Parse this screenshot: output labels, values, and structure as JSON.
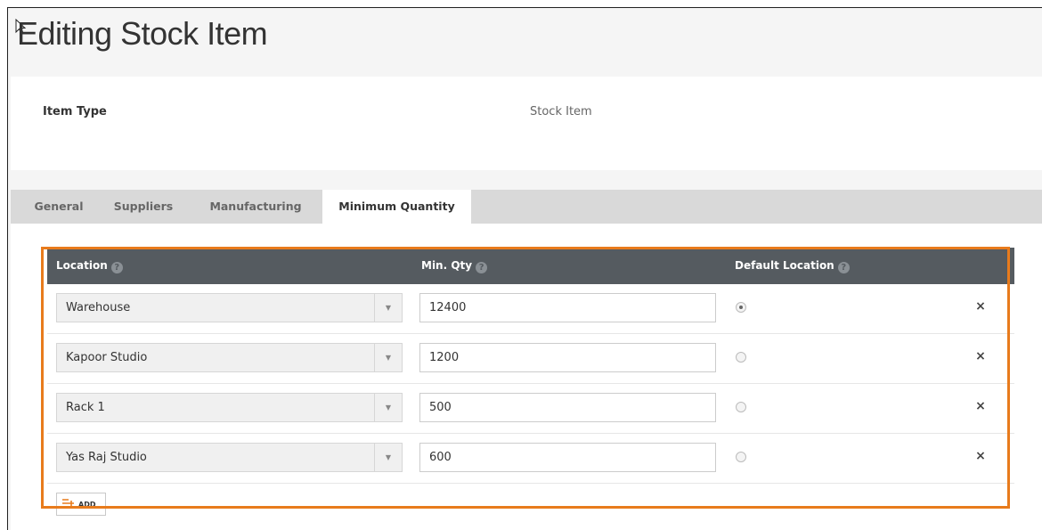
{
  "page": {
    "title": "Editing Stock Item"
  },
  "info": {
    "item_type_label": "Item Type",
    "item_type_value": "Stock Item"
  },
  "tabs": [
    {
      "label": "General"
    },
    {
      "label": "Suppliers"
    },
    {
      "label": "Manufacturing"
    },
    {
      "label": "Minimum Quantity",
      "active": true
    }
  ],
  "grid": {
    "columns": {
      "location": "Location",
      "min_qty": "Min. Qty",
      "default_location": "Default Location"
    },
    "help_glyph": "?",
    "dropdown_glyph": "▼",
    "remove_glyph": "×",
    "rows": [
      {
        "location": "Warehouse",
        "min_qty": "12400",
        "default": true
      },
      {
        "location": "Kapoor Studio",
        "min_qty": "1200",
        "default": false
      },
      {
        "location": "Rack 1",
        "min_qty": "500",
        "default": false
      },
      {
        "location": "Yas Raj Studio",
        "min_qty": "600",
        "default": false
      }
    ],
    "add_label": "ADD"
  },
  "colors": {
    "highlight": "#e87b1c",
    "header_bg": "#555b60",
    "tab_bar_bg": "#d9d9d9"
  },
  "icons": {
    "cursor": "mouse-pointer-icon",
    "help": "help-circle-icon",
    "dropdown": "chevron-down-icon",
    "remove": "close-icon",
    "add": "add-rows-icon"
  }
}
